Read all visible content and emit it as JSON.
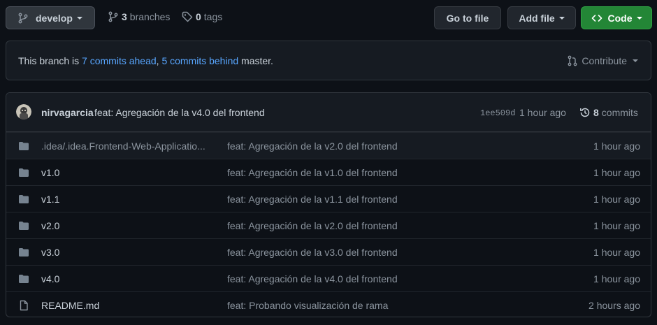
{
  "branch_button": {
    "icon": "git-branch-icon",
    "label": "develop"
  },
  "branches": {
    "count": "3",
    "label": "branches"
  },
  "tags": {
    "count": "0",
    "label": "tags"
  },
  "actions": {
    "go_to_file": "Go to file",
    "add_file": "Add file",
    "code": "Code"
  },
  "banner": {
    "prefix": "This branch is",
    "ahead": "7 commits ahead",
    "sep": ",",
    "behind": "5 commits behind",
    "suffix": "master.",
    "contribute": "Contribute"
  },
  "latest_commit": {
    "author": "nirvagarcia",
    "message": "feat: Agregación de la v4.0 del frontend",
    "sha": "1ee509d",
    "time": "1 hour ago",
    "count": "8",
    "count_label": "commits"
  },
  "files": [
    {
      "name": ".idea/.idea.Frontend-Web-Applicatio...",
      "message": "feat: Agregación de la v2.0 del frontend",
      "age": "1 hour ago",
      "type": "folder"
    },
    {
      "name": "v1.0",
      "message": "feat: Agregación de la v1.0 del frontend",
      "age": "1 hour ago",
      "type": "folder"
    },
    {
      "name": "v1.1",
      "message": "feat: Agregación de la v1.1 del frontend",
      "age": "1 hour ago",
      "type": "folder"
    },
    {
      "name": "v2.0",
      "message": "feat: Agregación de la v2.0 del frontend",
      "age": "1 hour ago",
      "type": "folder"
    },
    {
      "name": "v3.0",
      "message": "feat: Agregación de la v3.0 del frontend",
      "age": "1 hour ago",
      "type": "folder"
    },
    {
      "name": "v4.0",
      "message": "feat: Agregación de la v4.0 del frontend",
      "age": "1 hour ago",
      "type": "folder"
    },
    {
      "name": "README.md",
      "message": "feat: Probando visualización de rama",
      "age": "2 hours ago",
      "type": "file"
    }
  ],
  "colors": {
    "background": "#0d1117",
    "link": "#58a6ff",
    "code_button": "#238636",
    "muted": "#8b949e"
  }
}
